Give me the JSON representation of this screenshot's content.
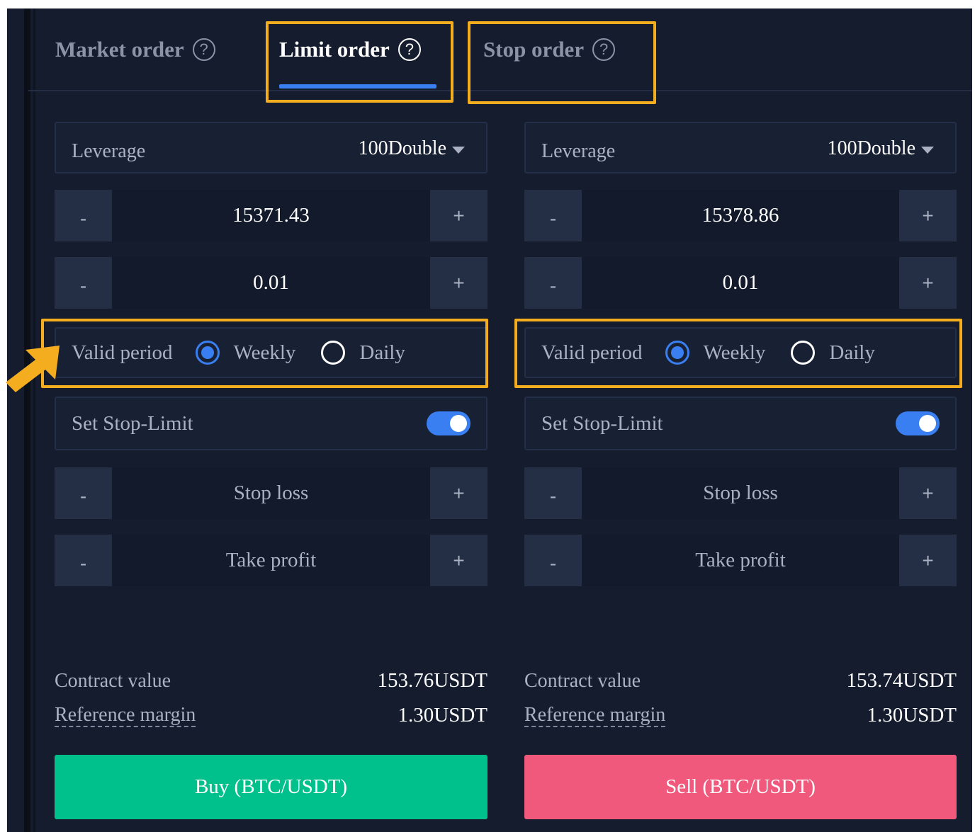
{
  "tabs": [
    {
      "label": "Market order",
      "active": false
    },
    {
      "label": "Limit order",
      "active": true
    },
    {
      "label": "Stop order",
      "active": false
    }
  ],
  "help_icon_glyph": "?",
  "stepper_buttons": {
    "minus": "-",
    "plus": "+"
  },
  "buy_panel": {
    "leverage_label": "Leverage",
    "leverage_value": "100Double",
    "price": "15371.43",
    "amount": "0.01",
    "valid_period_label": "Valid period",
    "valid_period_options": [
      "Weekly",
      "Daily"
    ],
    "valid_period_selected": "Weekly",
    "stop_limit_label": "Set Stop-Limit",
    "stop_limit_enabled": true,
    "stop_loss_placeholder": "Stop loss",
    "take_profit_placeholder": "Take profit",
    "contract_value_label": "Contract value",
    "contract_value": "153.76USDT",
    "reference_margin_label": "Reference margin",
    "reference_margin": "1.30USDT",
    "action_label": "Buy (BTC/USDT)"
  },
  "sell_panel": {
    "leverage_label": "Leverage",
    "leverage_value": "100Double",
    "price": "15378.86",
    "amount": "0.01",
    "valid_period_label": "Valid period",
    "valid_period_options": [
      "Weekly",
      "Daily"
    ],
    "valid_period_selected": "Weekly",
    "stop_limit_label": "Set Stop-Limit",
    "stop_limit_enabled": true,
    "stop_loss_placeholder": "Stop loss",
    "take_profit_placeholder": "Take profit",
    "contract_value_label": "Contract value",
    "contract_value": "153.74USDT",
    "reference_margin_label": "Reference margin",
    "reference_margin": "1.30USDT",
    "action_label": "Sell (BTC/USDT)"
  },
  "colors": {
    "background": "#141c2e",
    "accent": "#3a7ff1",
    "highlight": "#f4ad1e",
    "buy": "#00c08b",
    "sell": "#f0587c"
  }
}
